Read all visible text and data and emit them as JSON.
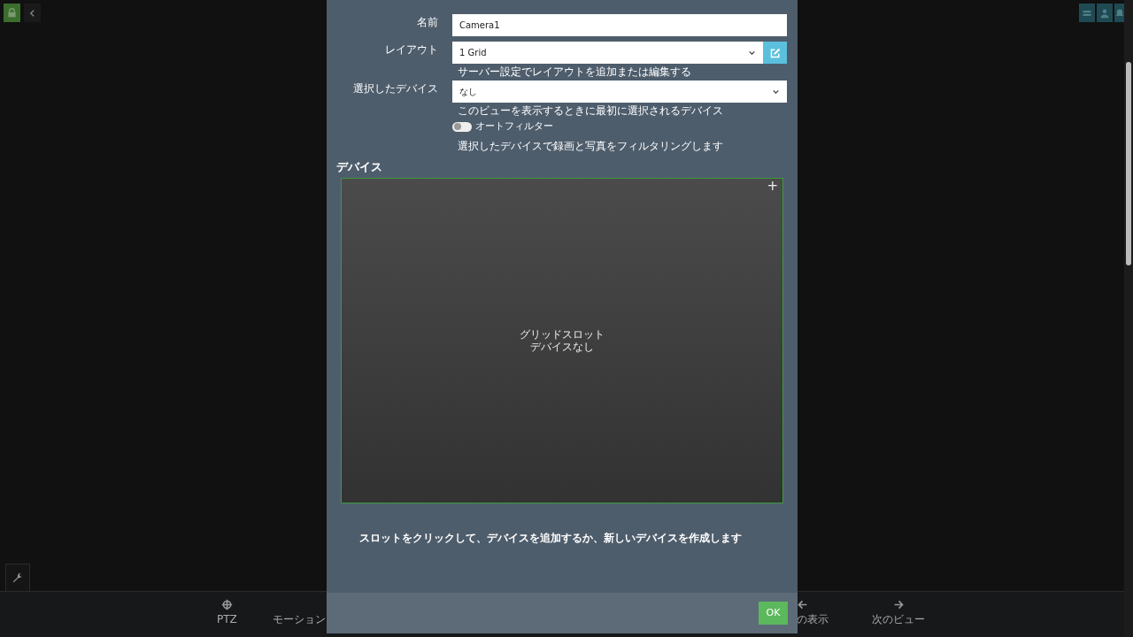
{
  "toolbar_top_right": [
    {
      "kind": "list"
    },
    {
      "kind": "user"
    },
    {
      "kind": "bell"
    }
  ],
  "lock": {
    "on": true
  },
  "bottom_bar": [
    {
      "kind": "ptz",
      "label": "PTZ"
    },
    {
      "kind": "none",
      "label": "モーション"
    },
    {
      "kind": "prev",
      "label": "の表示"
    },
    {
      "kind": "next",
      "label": "次のビュー"
    }
  ],
  "dialog": {
    "fields": [
      {
        "label": "名前",
        "kind": "text",
        "value": "Camera1"
      },
      {
        "label": "レイアウト",
        "kind": "select-edit",
        "value": "1 Grid",
        "help": "サーバー設定でレイアウトを追加または編集する"
      },
      {
        "label": "選択したデバイス",
        "kind": "select",
        "value": "なし",
        "help": "このビューを表示するときに最初に選択されるデバイス"
      }
    ],
    "auto_filter": {
      "label": "オートフィルター",
      "on": false,
      "help": "選択したデバイスで録画と写真をフィルタリングします"
    },
    "devices_heading": "デバイス",
    "slot": {
      "add_icon": "+",
      "lines": [
        "グリッドスロット",
        "デバイスなし"
      ]
    },
    "instruction": "スロットをクリックして、デバイスを追加するか、新しいデバイスを作成します",
    "ok": "OK"
  }
}
